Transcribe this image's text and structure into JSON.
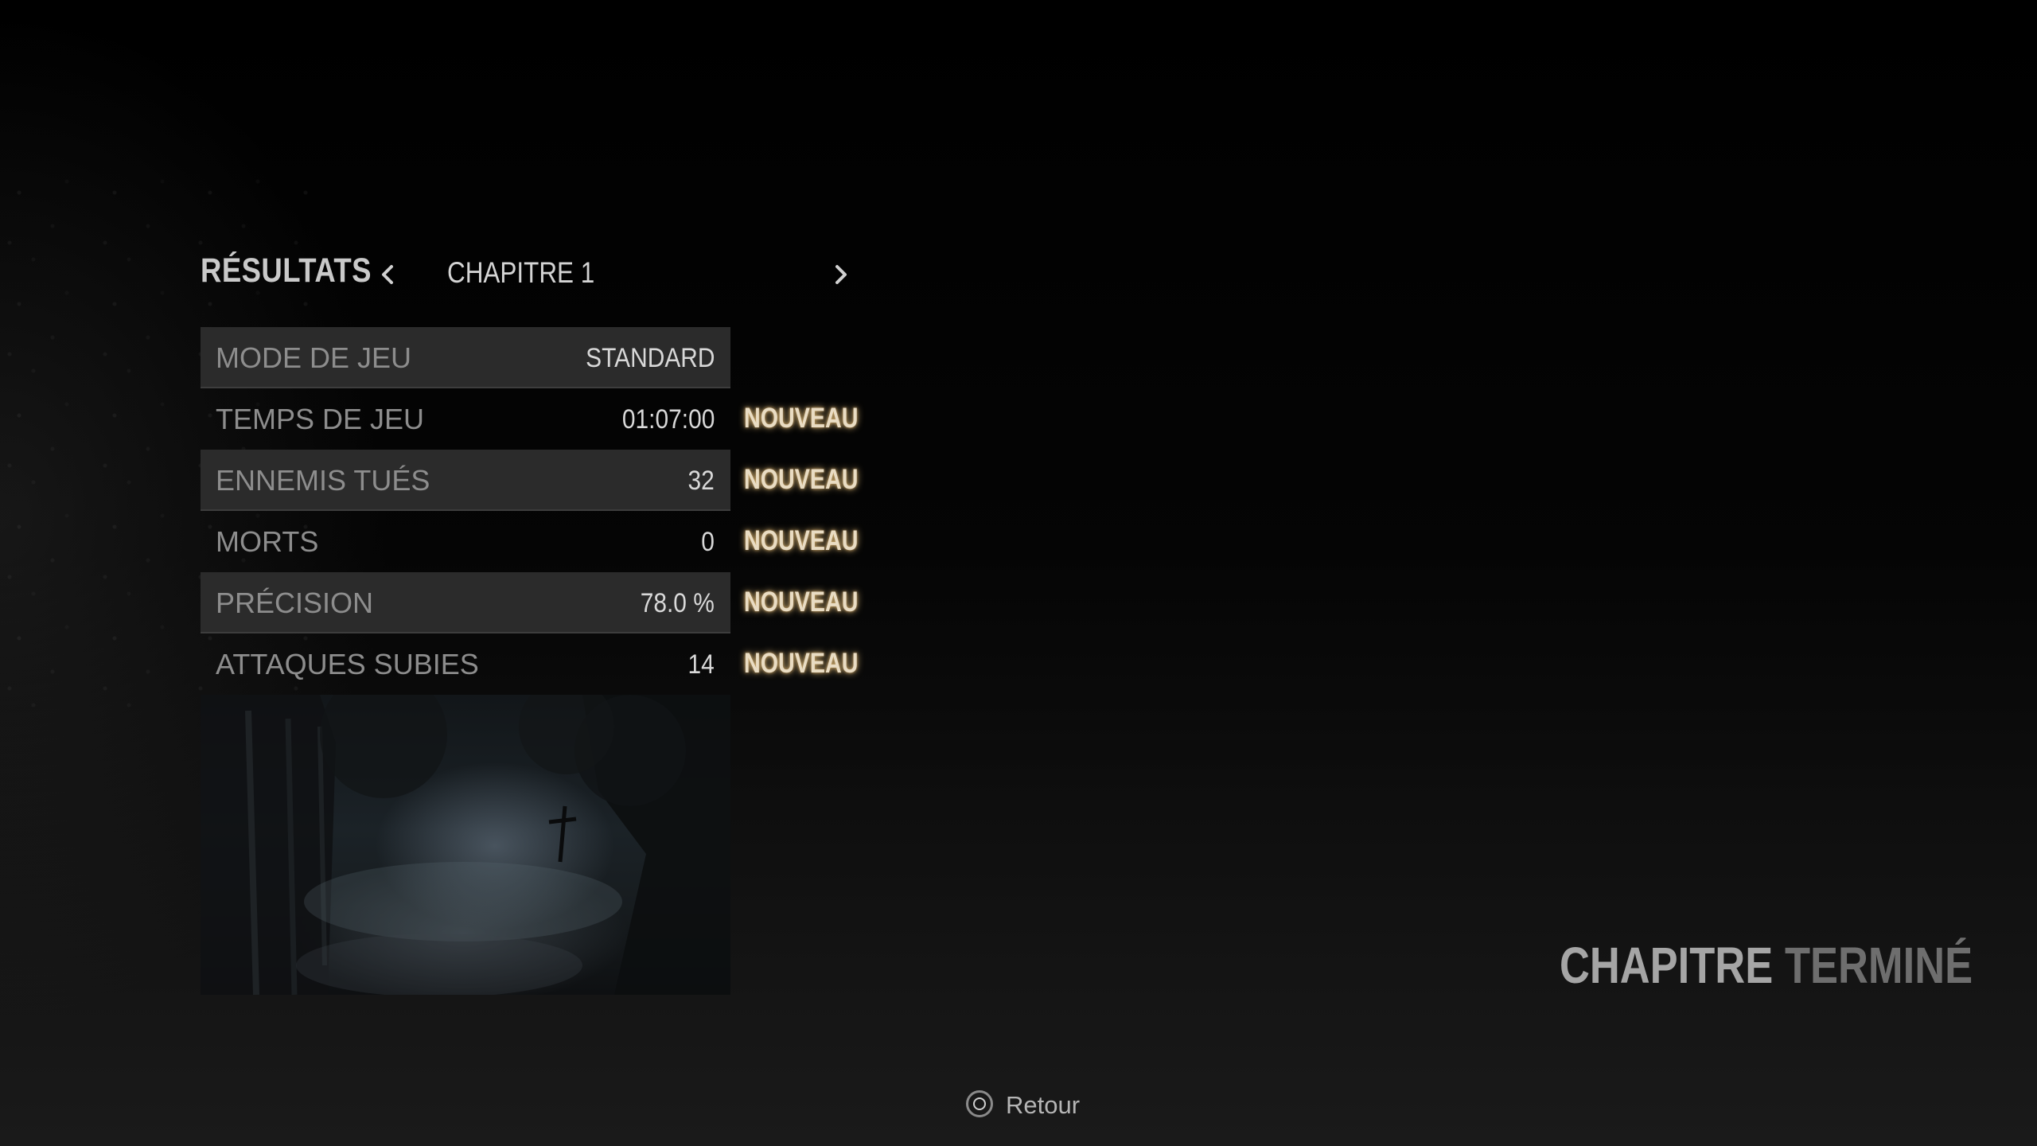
{
  "header": {
    "title": "RÉSULTATS",
    "chapter": "CHAPITRE 1"
  },
  "stats": [
    {
      "label": "MODE DE JEU",
      "value": "STANDARD",
      "badge": ""
    },
    {
      "label": "TEMPS DE JEU",
      "value": "01:07:00",
      "badge": "NOUVEAU"
    },
    {
      "label": "ENNEMIS TUÉS",
      "value": "32",
      "badge": "NOUVEAU"
    },
    {
      "label": "MORTS",
      "value": "0",
      "badge": "NOUVEAU"
    },
    {
      "label": "PRÉCISION",
      "value": "78.0 %",
      "badge": "NOUVEAU"
    },
    {
      "label": "ATTAQUES SUBIES",
      "value": "14",
      "badge": "NOUVEAU"
    }
  ],
  "chapter_complete": {
    "word1": "CHAPITRE",
    "word2": "TERMINÉ"
  },
  "footer": {
    "back_label": "Retour",
    "back_icon": "circle-button-icon"
  },
  "colors": {
    "badge": "#e9dcc3",
    "badge_glow": "#ffd78c",
    "row_shade": "#2b2b2b",
    "label": "#8d8d8d",
    "value": "#d8d8d8"
  }
}
